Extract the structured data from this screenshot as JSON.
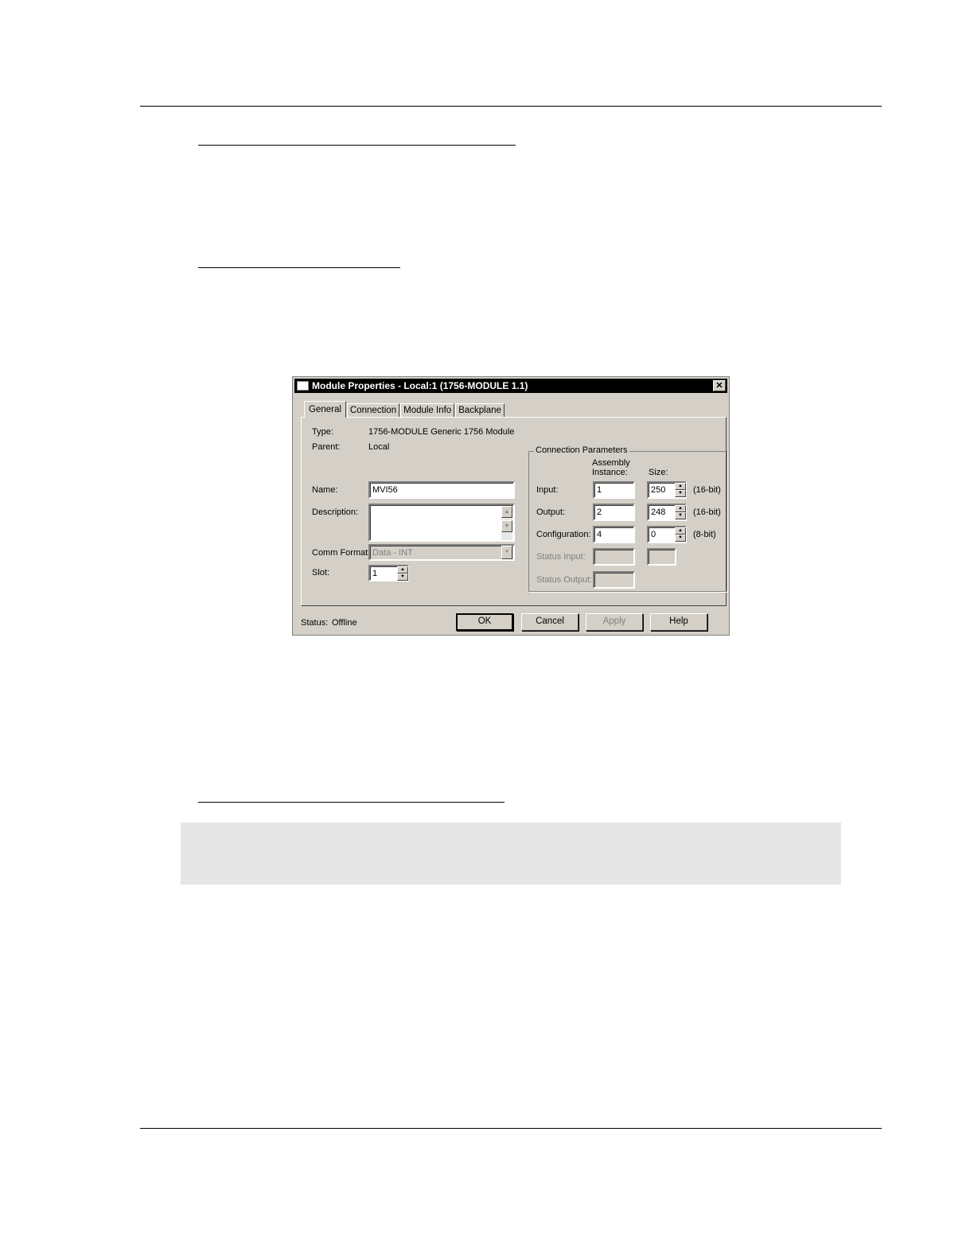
{
  "dialog": {
    "title": "Module Properties  - Local:1 (1756-MODULE 1.1)",
    "close_glyph": "✕",
    "tabs": [
      {
        "label": "General"
      },
      {
        "label": "Connection"
      },
      {
        "label": "Module Info"
      },
      {
        "label": "Backplane"
      }
    ],
    "general": {
      "type_label": "Type:",
      "type_value": "1756-MODULE Generic 1756 Module",
      "parent_label": "Parent:",
      "parent_value": "Local",
      "name_label": "Name:",
      "name_value": "MVI56",
      "description_label": "Description:",
      "description_value": "",
      "comm_format_label": "Comm Format:",
      "comm_format_value": "Data - INT",
      "slot_label": "Slot:",
      "slot_value": "1"
    },
    "connection_parameters": {
      "title": "Connection Parameters",
      "assembly_header": "Assembly\nInstance:",
      "size_header": "Size:",
      "rows": [
        {
          "label": "Input:",
          "instance": "1",
          "size": "250",
          "unit": "(16-bit)"
        },
        {
          "label": "Output:",
          "instance": "2",
          "size": "248",
          "unit": "(16-bit)"
        },
        {
          "label": "Configuration:",
          "instance": "4",
          "size": "0",
          "unit": "(8-bit)"
        },
        {
          "label": "Status Input:"
        },
        {
          "label": "Status Output:"
        }
      ]
    },
    "status_label": "Status:",
    "status_value": "Offline",
    "buttons": {
      "ok": "OK",
      "cancel": "Cancel",
      "apply": "Apply",
      "help": "Help"
    }
  }
}
